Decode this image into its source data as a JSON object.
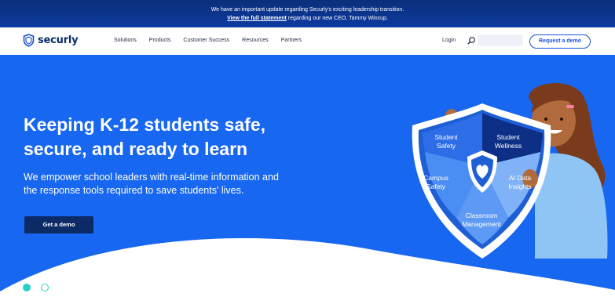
{
  "announcement": {
    "line1": "We have an important update regarding Securly's exciting leadership transition.",
    "link_text": "View the full statement",
    "line2_rest": " regarding our new CEO, Tammy Wincup."
  },
  "nav": {
    "logo_text": "securly",
    "logo_icon": "shield-icon",
    "menu": [
      "Solutions",
      "Products",
      "Customer Success",
      "Resources",
      "Partners"
    ],
    "login": "Login",
    "search_icon": "search-icon",
    "search_placeholder": "",
    "request_demo": "Request a demo"
  },
  "hero": {
    "headline_line1": "Keeping K-12 students safe,",
    "headline_line2": "secure, and ready to learn",
    "subhead_line1": "We empower school leaders with real-time information and",
    "subhead_line2": "the response tools required to save students' lives.",
    "cta": "Get a demo",
    "background_color": "#1767f0",
    "shield_segments": {
      "student_safety": [
        "Student",
        "Safety"
      ],
      "student_wellness": [
        "Student",
        "Wellness"
      ],
      "campus_safety": [
        "Campus",
        "Safety"
      ],
      "ai_data": [
        "AI Data",
        "Insights"
      ],
      "classroom": [
        "Classroom",
        "Management"
      ]
    },
    "carousel": {
      "total": 2,
      "active": 1
    }
  }
}
